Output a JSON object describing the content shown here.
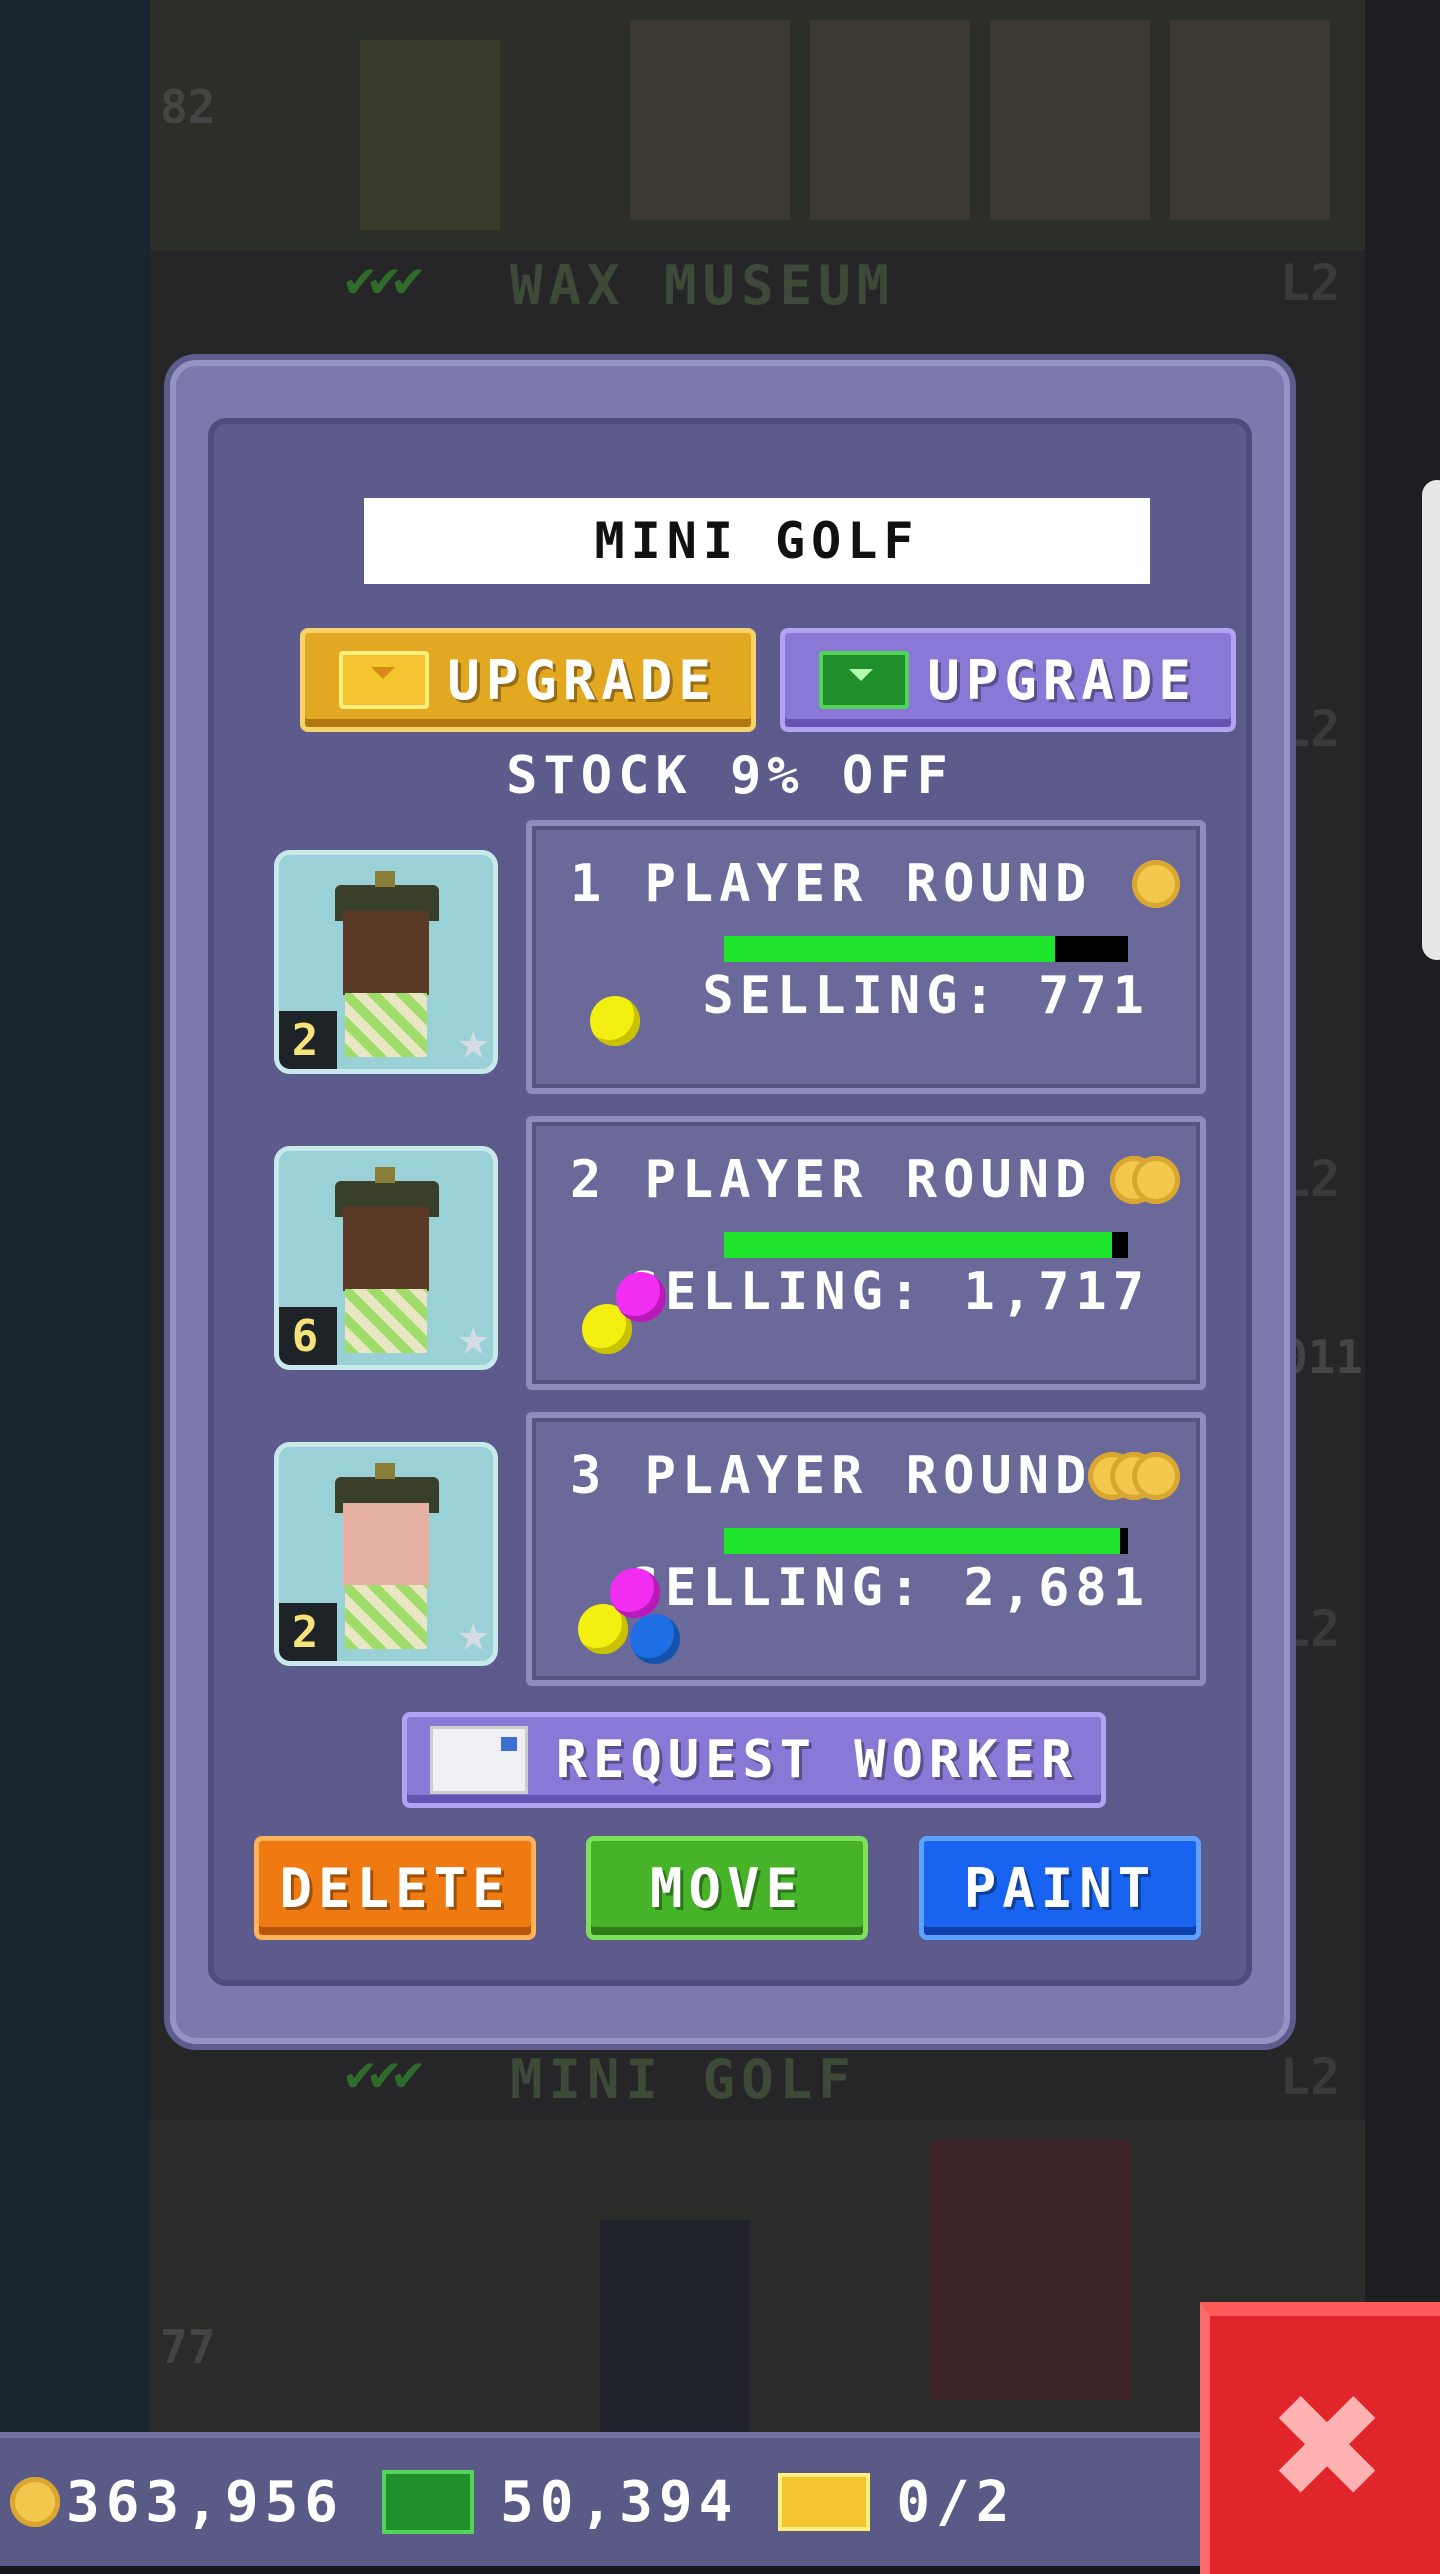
{
  "background": {
    "floor_top": {
      "number": "82",
      "label": "WAX MUSEUM",
      "level": "L2"
    },
    "floor_bottom": {
      "number": "77",
      "label": "MINI GOLF",
      "level": "L2"
    },
    "side_levels": [
      "L2",
      "L2",
      "L2"
    ],
    "side_number": "011"
  },
  "dialog": {
    "title": "MINI GOLF",
    "upgrade_gold_label": "UPGRADE",
    "upgrade_bux_label": "UPGRADE",
    "stock_discount": "STOCK 9% OFF",
    "products": [
      {
        "name": "1 PLAYER ROUND",
        "selling": "SELLING: 771",
        "progress": 0.82,
        "coins": 1,
        "worker_level": "2",
        "balls": [
          "yellow"
        ]
      },
      {
        "name": "2 PLAYER ROUND",
        "selling": "SELLING: 1,717",
        "progress": 0.96,
        "coins": 2,
        "worker_level": "6",
        "balls": [
          "yellow",
          "magenta"
        ]
      },
      {
        "name": "3 PLAYER ROUND",
        "selling": "SELLING: 2,681",
        "progress": 0.98,
        "coins": 3,
        "worker_level": "2",
        "balls": [
          "yellow",
          "magenta",
          "blue"
        ]
      }
    ],
    "request_worker_label": "REQUEST WORKER",
    "delete_label": "DELETE",
    "move_label": "MOVE",
    "paint_label": "PAINT"
  },
  "status": {
    "coins": "363,956",
    "bux": "50,394",
    "tickets": "0/2"
  },
  "colors": {
    "dialog_bg": "#5d5b8c",
    "progress": "#1ee42c",
    "delete": "#f07a12",
    "move": "#47b329",
    "paint": "#1863f0",
    "close": "#e0262a"
  },
  "icons": {
    "close": "close-x-icon",
    "coin": "coin-icon",
    "bux": "bux-icon",
    "ticket": "golden-ticket-icon",
    "envelope": "envelope-icon"
  }
}
